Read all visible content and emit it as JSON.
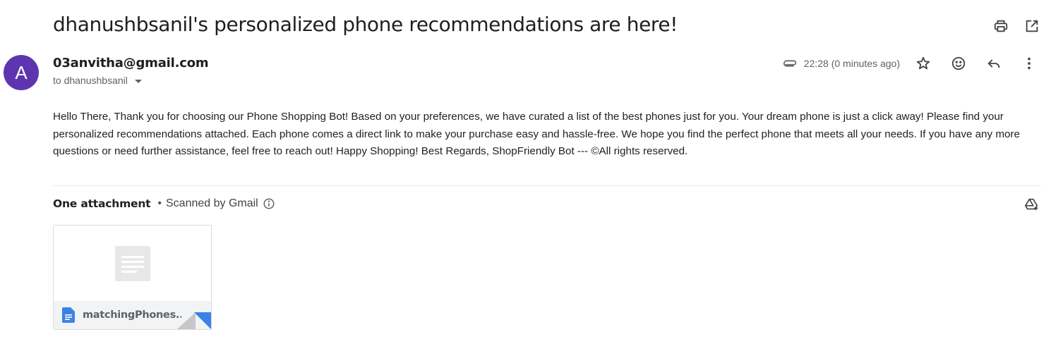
{
  "email": {
    "subject": "dhanushbsanil's personalized phone recommendations are here!",
    "sender": "03anvitha@gmail.com",
    "avatar_letter": "A",
    "avatar_color": "#5e35b1",
    "recipient": "to dhanushbsanil",
    "time": "22:28 (0 minutes ago)",
    "body": "Hello There,  Thank you for choosing our Phone Shopping Bot! Based on your preferences, we have curated a list of the best phones just for you. Your dream phone is just a click away! Please find your personalized recommendations attached. Each phone comes a direct link to make your purchase easy and hassle-free. We hope you find the perfect phone that meets all your needs. If you have any more questions or need further assistance, feel free to reach out! Happy Shopping! Best Regards, ShopFriendly Bot --- ©All rights reserved."
  },
  "attachments": {
    "count_label": "One attachment",
    "scanned_label": "Scanned by Gmail",
    "items": [
      {
        "name": "matchingPhones....",
        "icon": "google-docs-icon"
      }
    ]
  },
  "icons": {
    "print": "print-icon",
    "open_new_window": "open-in-new-window-icon",
    "attachment": "paperclip-icon",
    "star": "star-icon",
    "emoji": "emoji-icon",
    "reply": "reply-icon",
    "more": "more-vert-icon",
    "info": "info-icon",
    "drive": "add-to-drive-icon"
  },
  "colors": {
    "doc_blue": "#3b82e6"
  }
}
